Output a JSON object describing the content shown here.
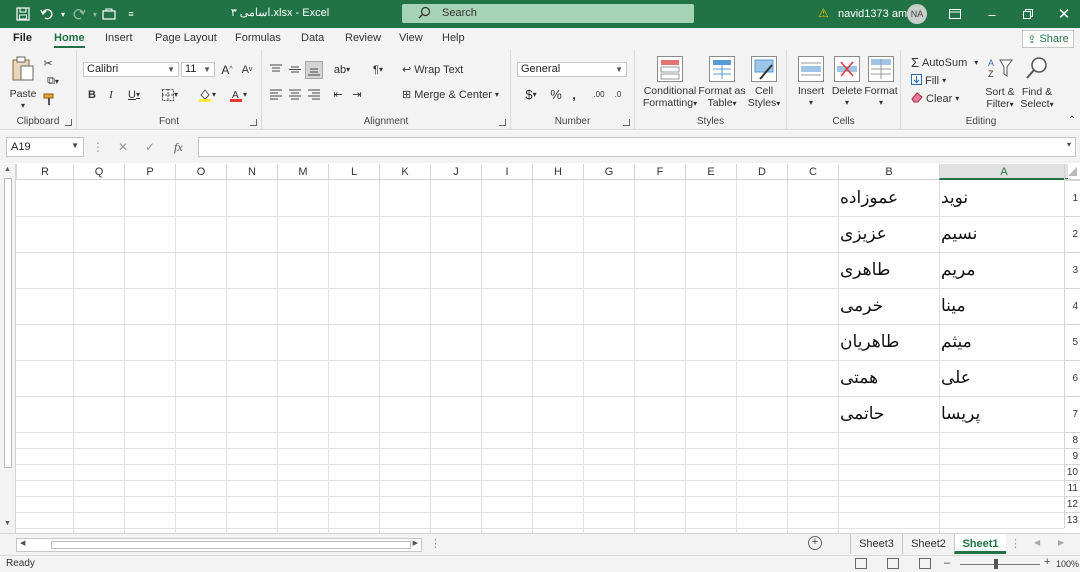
{
  "titlebar": {
    "doc_title": "اسامی ۳.xlsx  -  Excel",
    "search_label": "Search",
    "user_name": "navid1373 amz",
    "avatar_initials": "NA"
  },
  "menu": {
    "file": "File",
    "tabs": [
      "Home",
      "Insert",
      "Page Layout",
      "Formulas",
      "Data",
      "Review",
      "View",
      "Help"
    ],
    "share": "Share"
  },
  "ribbon": {
    "clipboard": {
      "paste": "Paste",
      "label": "Clipboard"
    },
    "font": {
      "family": "Calibri",
      "size": "11",
      "label": "Font"
    },
    "alignment": {
      "wrap": "Wrap Text",
      "merge": "Merge & Center",
      "label": "Alignment"
    },
    "number": {
      "format": "General",
      "label": "Number"
    },
    "styles": {
      "conditional_1": "Conditional",
      "conditional_2": "Formatting",
      "format_table_1": "Format as",
      "format_table_2": "Table",
      "cell_styles_1": "Cell",
      "cell_styles_2": "Styles",
      "label": "Styles"
    },
    "cells": {
      "insert": "Insert",
      "delete": "Delete",
      "format": "Format",
      "label": "Cells"
    },
    "editing": {
      "autosum": "AutoSum",
      "fill": "Fill",
      "clear": "Clear",
      "sort_1": "Sort &",
      "sort_2": "Filter",
      "find_1": "Find &",
      "find_2": "Select",
      "label": "Editing"
    }
  },
  "formula_bar": {
    "name_box": "A19",
    "fx": "fx",
    "value": ""
  },
  "sheet": {
    "columns": [
      "R",
      "Q",
      "P",
      "O",
      "N",
      "M",
      "L",
      "K",
      "J",
      "I",
      "H",
      "G",
      "F",
      "E",
      "D",
      "C",
      "B",
      "A"
    ],
    "selected_column": "A",
    "rows": [
      "1",
      "2",
      "3",
      "4",
      "5",
      "6",
      "7",
      "8",
      "9",
      "10",
      "11",
      "12",
      "13"
    ],
    "column_a": [
      "نوید",
      "نسیم",
      "مریم",
      "مینا",
      "میثم",
      "علی",
      "پریسا"
    ],
    "column_b": [
      "عموزاده",
      "عزیزی",
      "طاهری",
      "خرمی",
      "طاهریان",
      "همتی",
      "حاتمی"
    ]
  },
  "sheet_tabs": {
    "tabs": [
      "Sheet3",
      "Sheet2",
      "Sheet1"
    ],
    "active": "Sheet1"
  },
  "status": {
    "ready": "Ready",
    "zoom": "100%"
  },
  "colors": {
    "accent": "#217346"
  }
}
